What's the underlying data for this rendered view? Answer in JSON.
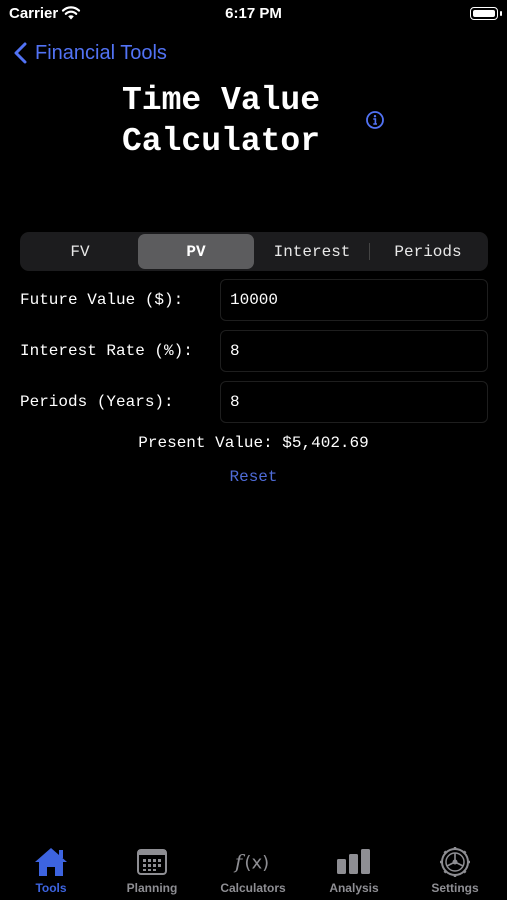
{
  "status_bar": {
    "carrier": "Carrier",
    "time": "6:17 PM"
  },
  "nav": {
    "back_label": "Financial Tools"
  },
  "title": "Time Value Calculator",
  "segments": [
    {
      "label": "FV",
      "active": false
    },
    {
      "label": "PV",
      "active": true
    },
    {
      "label": "Interest",
      "active": false
    },
    {
      "label": "Periods",
      "active": false
    }
  ],
  "form": {
    "future_value": {
      "label": "Future Value ($):",
      "value": "10000"
    },
    "interest_rate": {
      "label": "Interest Rate (%):",
      "value": "8"
    },
    "periods": {
      "label": "Periods (Years):",
      "value": "8"
    }
  },
  "result": "Present Value: $5,402.69",
  "reset_label": "Reset",
  "tabs": [
    {
      "label": "Tools",
      "icon": "house-icon",
      "active": true
    },
    {
      "label": "Planning",
      "icon": "calendar-grid-icon",
      "active": false
    },
    {
      "label": "Calculators",
      "icon": "function-icon",
      "active": false
    },
    {
      "label": "Analysis",
      "icon": "bar-chart-icon",
      "active": false
    },
    {
      "label": "Settings",
      "icon": "gear-icon",
      "active": false
    }
  ],
  "colors": {
    "accent": "#3d64e0",
    "link": "#5273f5",
    "background": "#000000",
    "segment_bg": "#1c1c1e",
    "segment_active": "#5c5c5e",
    "inactive_tab": "#8e8e93"
  }
}
